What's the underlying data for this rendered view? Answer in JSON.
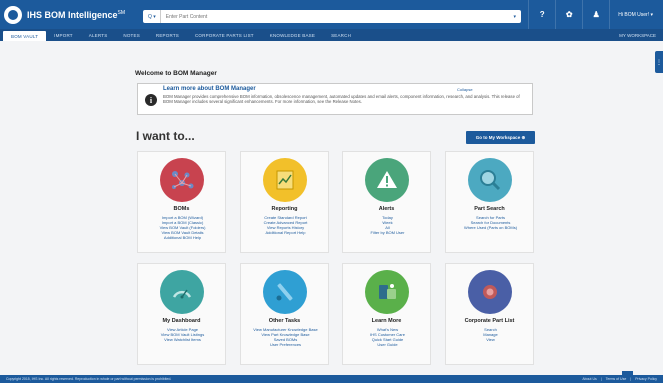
{
  "header": {
    "brand": "IHS BOM Intelligence",
    "brand_sup": "SM",
    "search": {
      "scope": "Q ▾",
      "placeholder": "Enter Part Content"
    },
    "user_label": "Hi BOM User!"
  },
  "nav": {
    "items": [
      "BOM VAULT",
      "IMPORT",
      "ALERTS",
      "NOTES",
      "REPORTS",
      "CORPORATE PARTS LIST",
      "KNOWLEDGE BASE",
      "SEARCH"
    ],
    "right": "MY WORKSPACE"
  },
  "welcome": "Welcome to BOM Manager",
  "info": {
    "title": "Learn more about BOM Manager",
    "collapse": "Collapse",
    "text": "BOM Manager provides comprehensive BOM information, obsolescence management, automated updates and email alerts, component information, research, and analysis. This release of BOM Manager includes several significant enhancements. For more information, see the Release Notes."
  },
  "iwant": "I want to...",
  "workspace_button": "Go to My Workspace ⊕",
  "cards": [
    {
      "title": "BOMs",
      "icon": "bom-network-icon",
      "color": "#c8434f",
      "links": [
        "Import a BOM (Wizard)",
        "Import a BOM (Classic)",
        "View BOM Vault (Folders)",
        "View BOM Vault Details",
        "Additional BOM Help"
      ]
    },
    {
      "title": "Reporting",
      "icon": "report-chart-icon",
      "color": "#f2c02a",
      "links": [
        "Create Standard Report",
        "Create Advanced Report",
        "View Reports History",
        "Additional Report Help"
      ]
    },
    {
      "title": "Alerts",
      "icon": "alert-warning-icon",
      "color": "#4aa57b",
      "links": [
        "Today",
        "Week",
        "All",
        "Filter by BOM User"
      ]
    },
    {
      "title": "Part Search",
      "icon": "part-search-icon",
      "color": "#4ca9c1",
      "links": [
        "Search for Parts",
        "Search for Documents",
        "Where Used (Parts on BOMs)"
      ]
    },
    {
      "title": "My Dashboard",
      "icon": "dashboard-icon",
      "color": "#3ea5a2",
      "links": [
        "View Article Page",
        "View BOM Vault Listings",
        "View Watchlist Items"
      ]
    },
    {
      "title": "Other Tasks",
      "icon": "other-tasks-icon",
      "color": "#2f9fd3",
      "links": [
        "View Manufacturer Knowledge Base",
        "View Part Knowledge Base",
        "Saved BOMs",
        "User Preferences"
      ]
    },
    {
      "title": "Learn More",
      "icon": "learn-more-icon",
      "color": "#5ab04a",
      "links": [
        "What's New",
        "IHS Customer Care",
        "Quick Start Guide",
        "User Guide"
      ]
    },
    {
      "title": "Corporate Part List",
      "icon": "corporate-list-icon",
      "color": "#4a5fa6",
      "links": [
        "Search",
        "Manage",
        "View"
      ]
    }
  ],
  "footer": {
    "copyright": "Copyright 2015, IHS Inc. All rights reserved. Reproduction in whole or part without permission is prohibited.",
    "links": [
      "About Us",
      "Terms of Use",
      "Privacy Policy"
    ]
  }
}
